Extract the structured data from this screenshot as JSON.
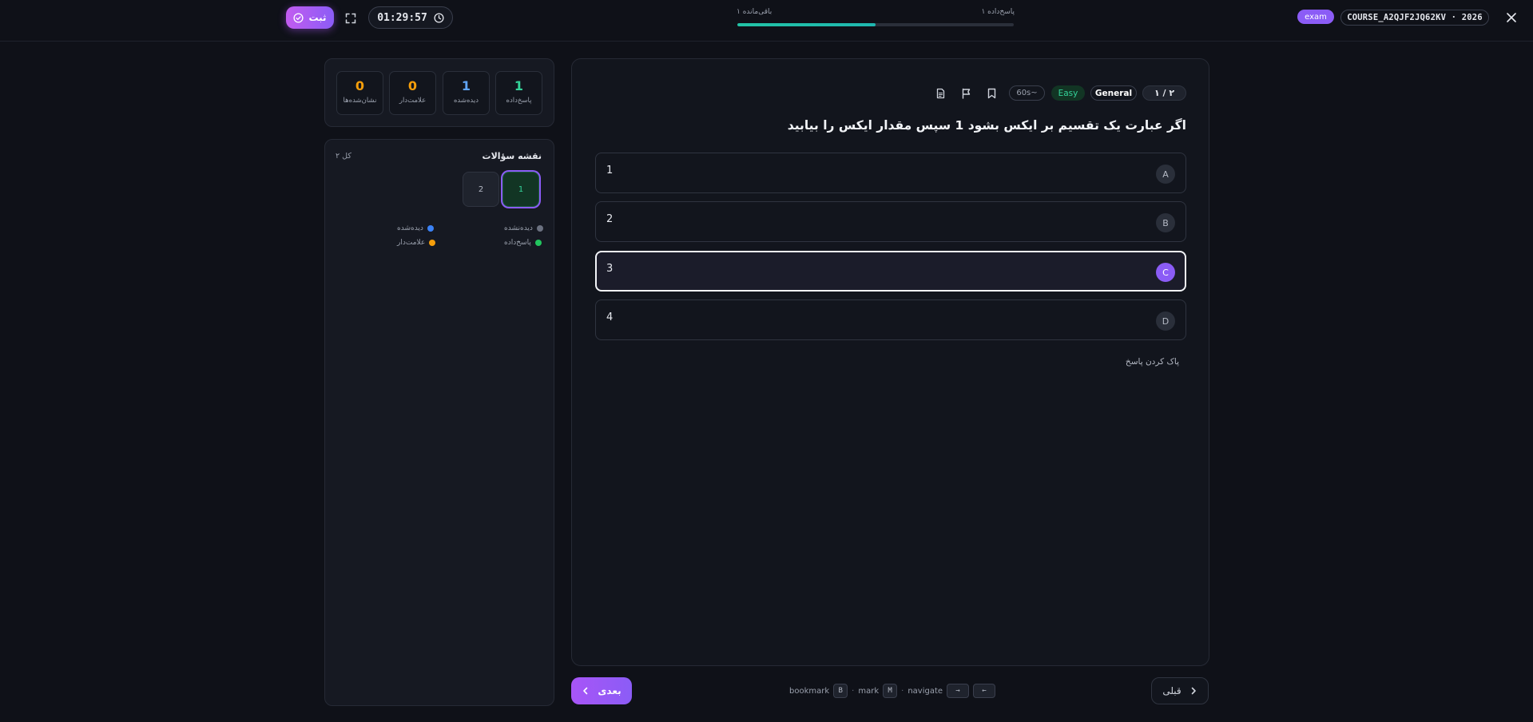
{
  "header": {
    "course_id": "COURSE_A2QJF2JQ62KV · 2026",
    "mode_badge": "exam",
    "answered_progress": "۱ پاسخ‌داده",
    "remaining_progress": "۱ باقی‌مانده",
    "progress_fraction": 0.5,
    "timer": "01:29:57",
    "submit_label": "ثبت"
  },
  "stats": [
    {
      "label": "پاسخ‌داده",
      "value": "1",
      "color": "#34d399"
    },
    {
      "label": "دیده‌شده",
      "value": "1",
      "color": "#60a5fa"
    },
    {
      "label": "علامت‌دار",
      "value": "0",
      "color": "#f59e0b"
    },
    {
      "label": "نشان‌شده‌ها",
      "value": "0",
      "color": "#f59e0b"
    }
  ],
  "question_map": {
    "title": "نقشه سؤالات",
    "total": "۲ کل",
    "cells": [
      "1",
      "2"
    ],
    "legend": [
      {
        "label": "دیده‌نشده",
        "color": "#6b7180"
      },
      {
        "label": "دیده‌شده",
        "color": "#3b82f6"
      },
      {
        "label": "پاسخ‌داده",
        "color": "#22c55e"
      },
      {
        "label": "علامت‌دار",
        "color": "#f59e0b"
      }
    ]
  },
  "question": {
    "counter": "۱ / ۲",
    "category": "General",
    "difficulty": "Easy",
    "time_estimate": "60s~",
    "text": "اگر عبارت یک تقسیم بر ایکس بشود 1 سپس مقدار ایکس را بیابید",
    "options": [
      {
        "letter": "A",
        "value": "1"
      },
      {
        "letter": "B",
        "value": "2"
      },
      {
        "letter": "C",
        "value": "3"
      },
      {
        "letter": "D",
        "value": "4"
      }
    ],
    "selected_option": "C",
    "clear_label": "پاک کردن پاسخ"
  },
  "footer": {
    "next_label": "بعدی",
    "prev_label": "قبلی",
    "shortcuts": {
      "bookmark_label": "bookmark",
      "bookmark_key": "B",
      "mark_label": "mark",
      "mark_key": "M",
      "navigate_label": "navigate",
      "nav_key_right": "→",
      "nav_key_left": "←",
      "separator": "·"
    }
  },
  "icons": {
    "close": "close-icon",
    "fullscreen": "fullscreen-icon",
    "clock": "clock-icon",
    "submit": "check-circle-icon",
    "bookmark": "bookmark-icon",
    "flag": "flag-icon",
    "notes": "document-icon",
    "next": "chevron-left-icon",
    "prev": "chevron-right-icon"
  }
}
